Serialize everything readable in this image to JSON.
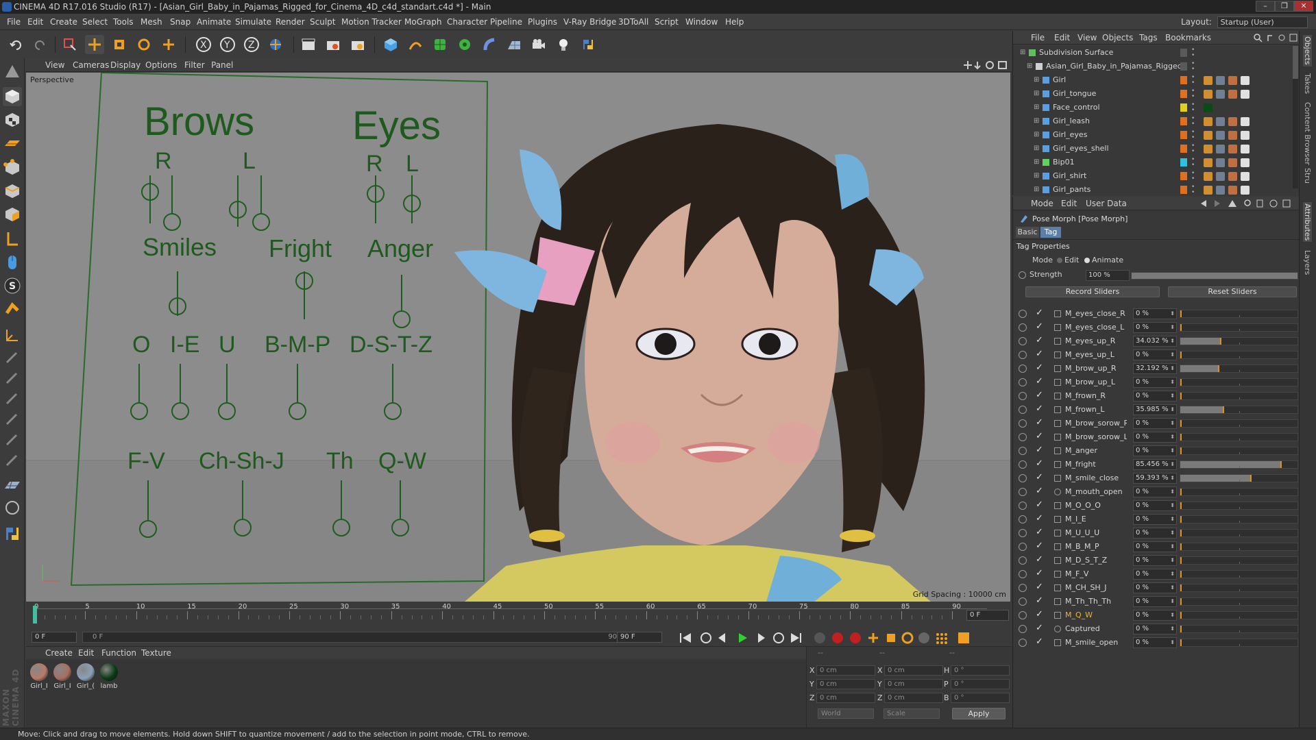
{
  "window": {
    "title": "CINEMA 4D R17.016 Studio (R17) - [Asian_Girl_Baby_in_Pajamas_Rigged_for_Cinema_4D_c4d_standart.c4d *] - Main",
    "minimize": "–",
    "maximize": "❐",
    "close": "✕"
  },
  "menubar": {
    "items": [
      "File",
      "Edit",
      "Create",
      "Select",
      "Tools",
      "Mesh",
      "Snap",
      "Animate",
      "Simulate",
      "Render",
      "Sculpt",
      "Motion Tracker",
      "MoGraph",
      "Character",
      "Pipeline",
      "Plugins",
      "V-Ray Bridge",
      "3DToAll",
      "Script",
      "Window",
      "Help"
    ],
    "layout_label": "Layout:",
    "layout_value": "Startup (User)"
  },
  "toolbar": {
    "axis_x": "X",
    "axis_y": "Y",
    "axis_z": "Z"
  },
  "viewport": {
    "menu": [
      "View",
      "Cameras",
      "Display",
      "Options",
      "Filter",
      "Panel"
    ],
    "camera_label": "Perspective",
    "grid_spacing": "Grid Spacing : 10000 cm",
    "rig_labels": {
      "brows": "Brows",
      "eyes": "Eyes",
      "r1": "R",
      "l1": "L",
      "r2": "R",
      "l2": "L",
      "smiles": "Smiles",
      "fright": "Fright",
      "anger": "Anger",
      "o": "O",
      "ie": "I-E",
      "u": "U",
      "bmp": "B-M-P",
      "dstz": "D-S-T-Z",
      "fv": "F-V",
      "chshj": "Ch-Sh-J",
      "th": "Th",
      "qw": "Q-W"
    }
  },
  "timeline": {
    "ticks": [
      "0",
      "5",
      "10",
      "15",
      "20",
      "25",
      "30",
      "35",
      "40",
      "45",
      "50",
      "55",
      "60",
      "65",
      "70",
      "75",
      "80",
      "85",
      "90"
    ],
    "current_frame": "0 F",
    "start_field": "0 F",
    "range_start": "0 F",
    "range_end": "90 F",
    "end_field": "90 F"
  },
  "material_manager": {
    "menu": [
      "Create",
      "Edit",
      "Function",
      "Texture"
    ],
    "materials": [
      {
        "label": "Girl_I",
        "color": "#b87a6a"
      },
      {
        "label": "Girl_I",
        "color": "#a86e62"
      },
      {
        "label": "Girl_(",
        "color": "#8aa0b8"
      },
      {
        "label": "lamb",
        "color": "#0a3a14"
      }
    ]
  },
  "coordinates": {
    "hdr1": "--",
    "hdr2": "--",
    "hdr3": "--",
    "x": "X",
    "y": "Y",
    "z": "Z",
    "x2": "X",
    "y2": "Y",
    "z2": "Z",
    "h": "H",
    "p": "P",
    "b": "B",
    "pos_x": "0 cm",
    "pos_y": "0 cm",
    "pos_z": "0 cm",
    "size_x": "0 cm",
    "size_y": "0 cm",
    "size_z": "0 cm",
    "rot_h": "0 °",
    "rot_p": "0 °",
    "rot_b": "0 °",
    "world": "World",
    "scale": "Scale",
    "apply": "Apply"
  },
  "status": "Move: Click and drag to move elements. Hold down SHIFT to quantize movement / add to the selection in point mode, CTRL to remove.",
  "objects": {
    "menu": [
      "File",
      "Edit",
      "View",
      "Objects",
      "Tags",
      "Bookmarks"
    ],
    "items": [
      {
        "name": "Subdivision Surface",
        "indent": 0,
        "icon_color": "#5fbf5f",
        "dot": "#5a5a5a"
      },
      {
        "name": "Asian_Girl_Baby_in_Pajamas_Rigged",
        "indent": 1,
        "icon_color": "#d0d0d0",
        "dot": "#5a5a5a"
      },
      {
        "name": "Girl",
        "indent": 2,
        "icon_color": "#5aa0e0",
        "dot": "#e07020"
      },
      {
        "name": "Girl_tongue",
        "indent": 2,
        "icon_color": "#5aa0e0",
        "dot": "#e07020"
      },
      {
        "name": "Face_control",
        "indent": 2,
        "icon_color": "#5aa0e0",
        "dot": "#e0d020"
      },
      {
        "name": "Girl_leash",
        "indent": 2,
        "icon_color": "#5aa0e0",
        "dot": "#e07020"
      },
      {
        "name": "Girl_eyes",
        "indent": 2,
        "icon_color": "#5aa0e0",
        "dot": "#e07020"
      },
      {
        "name": "Girl_eyes_shell",
        "indent": 2,
        "icon_color": "#5aa0e0",
        "dot": "#e07020"
      },
      {
        "name": "Bip01",
        "indent": 2,
        "icon_color": "#60d060",
        "dot": "#30c0e0"
      },
      {
        "name": "Girl_shirt",
        "indent": 2,
        "icon_color": "#5aa0e0",
        "dot": "#e07020"
      },
      {
        "name": "Girl_pants",
        "indent": 2,
        "icon_color": "#5aa0e0",
        "dot": "#e07020"
      }
    ]
  },
  "attributes": {
    "menu": [
      "Mode",
      "Edit",
      "User Data"
    ],
    "title": "Pose Morph [Pose Morph]",
    "tab_basic": "Basic",
    "tab_tag": "Tag",
    "section": "Tag Properties",
    "mode_label": "Mode",
    "mode_edit": "Edit",
    "mode_animate": "Animate",
    "strength_label": "Strength",
    "strength_value": "100 %",
    "strength_fraction": 1.0,
    "record_sliders": "Record Sliders",
    "reset_sliders": "Reset Sliders",
    "morphs": [
      {
        "name": "M_eyes_close_R",
        "value": "0 %",
        "fraction": 0
      },
      {
        "name": "M_eyes_close_L",
        "value": "0 %",
        "fraction": 0
      },
      {
        "name": "M_eyes_up_R",
        "value": "34.032 %",
        "fraction": 0.34032
      },
      {
        "name": "M_eyes_up_L",
        "value": "0 %",
        "fraction": 0
      },
      {
        "name": "M_brow_up_R",
        "value": "32.192 %",
        "fraction": 0.32192
      },
      {
        "name": "M_brow_up_L",
        "value": "0 %",
        "fraction": 0
      },
      {
        "name": "M_frown_R",
        "value": "0 %",
        "fraction": 0
      },
      {
        "name": "M_frown_L",
        "value": "35.985 %",
        "fraction": 0.35985
      },
      {
        "name": "M_brow_sorow_R",
        "value": "0 %",
        "fraction": 0
      },
      {
        "name": "M_brow_sorow_L",
        "value": "0 %",
        "fraction": 0
      },
      {
        "name": "M_anger",
        "value": "0 %",
        "fraction": 0
      },
      {
        "name": "M_fright",
        "value": "85.456 %",
        "fraction": 0.85456
      },
      {
        "name": "M_smile_close",
        "value": "59.393 %",
        "fraction": 0.59393
      },
      {
        "name": "M_mouth_open",
        "value": "0 %",
        "fraction": 0
      },
      {
        "name": "M_O_O_O",
        "value": "0 %",
        "fraction": 0
      },
      {
        "name": "M_I_E",
        "value": "0 %",
        "fraction": 0
      },
      {
        "name": "M_U_U_U",
        "value": "0 %",
        "fraction": 0
      },
      {
        "name": "M_B_M_P",
        "value": "0 %",
        "fraction": 0
      },
      {
        "name": "M_D_S_T_Z",
        "value": "0 %",
        "fraction": 0
      },
      {
        "name": "M_F_V",
        "value": "0 %",
        "fraction": 0
      },
      {
        "name": "M_CH_SH_J",
        "value": "0 %",
        "fraction": 0
      },
      {
        "name": "M_Th_Th_Th",
        "value": "0 %",
        "fraction": 0
      },
      {
        "name": "M_Q_W",
        "value": "0 %",
        "fraction": 0,
        "highlight": true
      },
      {
        "name": "Captured",
        "value": "0 %",
        "fraction": 0
      },
      {
        "name": "M_smile_open",
        "value": "0 %",
        "fraction": 0
      }
    ]
  },
  "right_tabs": [
    "Objects",
    "Takes",
    "Content Browser",
    "Stru",
    "Attributes",
    "Layers"
  ],
  "brand": "MAXON CINEMA 4D"
}
